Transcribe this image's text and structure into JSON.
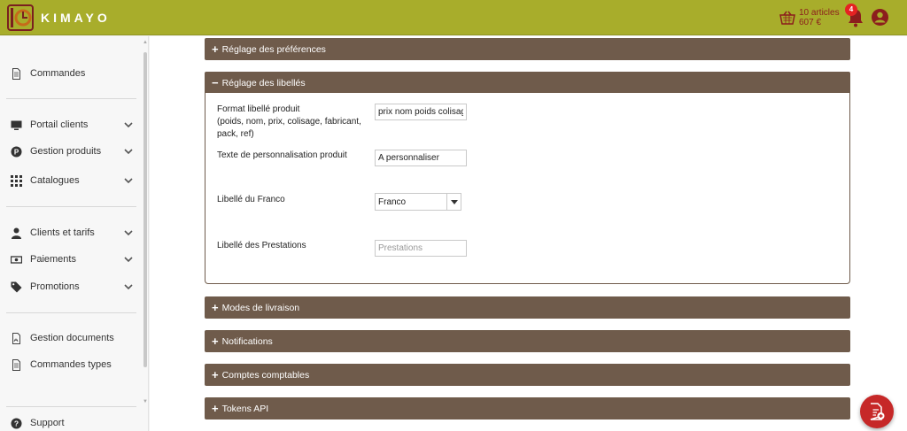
{
  "header": {
    "logo_text": "KIMAYO",
    "cart_count": "10 articles",
    "cart_total": "607 €",
    "notifications_count": "4"
  },
  "sidebar": {
    "items": [
      {
        "label": "Commandes",
        "icon": "document-icon"
      },
      {
        "label": "Portail clients",
        "icon": "monitor-icon"
      },
      {
        "label": "Gestion produits",
        "icon": "p-badge-icon"
      },
      {
        "label": "Catalogues",
        "icon": "grid-icon"
      },
      {
        "label": "Clients et tarifs",
        "icon": "person-icon"
      },
      {
        "label": "Paiements",
        "icon": "money-icon"
      },
      {
        "label": "Promotions",
        "icon": "tag-icon"
      },
      {
        "label": "Gestion documents",
        "icon": "pdf-file-icon"
      },
      {
        "label": "Commandes types",
        "icon": "document-icon"
      },
      {
        "label": "Support",
        "icon": "question-icon"
      }
    ]
  },
  "sections": {
    "preferences": "Réglage des préférences",
    "labels": "Réglage des libellés",
    "delivery": "Modes de livraison",
    "notifications": "Notifications",
    "accounts": "Comptes comptables",
    "tokens": "Tokens API"
  },
  "form": {
    "format_label_line1": "Format libellé produit",
    "format_label_line2": "(poids, nom, prix, colisage, fabricant,",
    "format_label_line3": "pack, ref)",
    "format_value": "prix nom poids colisage",
    "custom_label": "Texte de personnalisation produit",
    "custom_value": "A personnaliser",
    "franco_label": "Libellé du Franco",
    "franco_value": "Franco",
    "prestations_label": "Libellé des Prestations",
    "prestations_placeholder": "Prestations"
  },
  "colors": {
    "topbar": "#a8ad2b",
    "panel": "#6f5b4b",
    "accent_red": "#c62828"
  }
}
